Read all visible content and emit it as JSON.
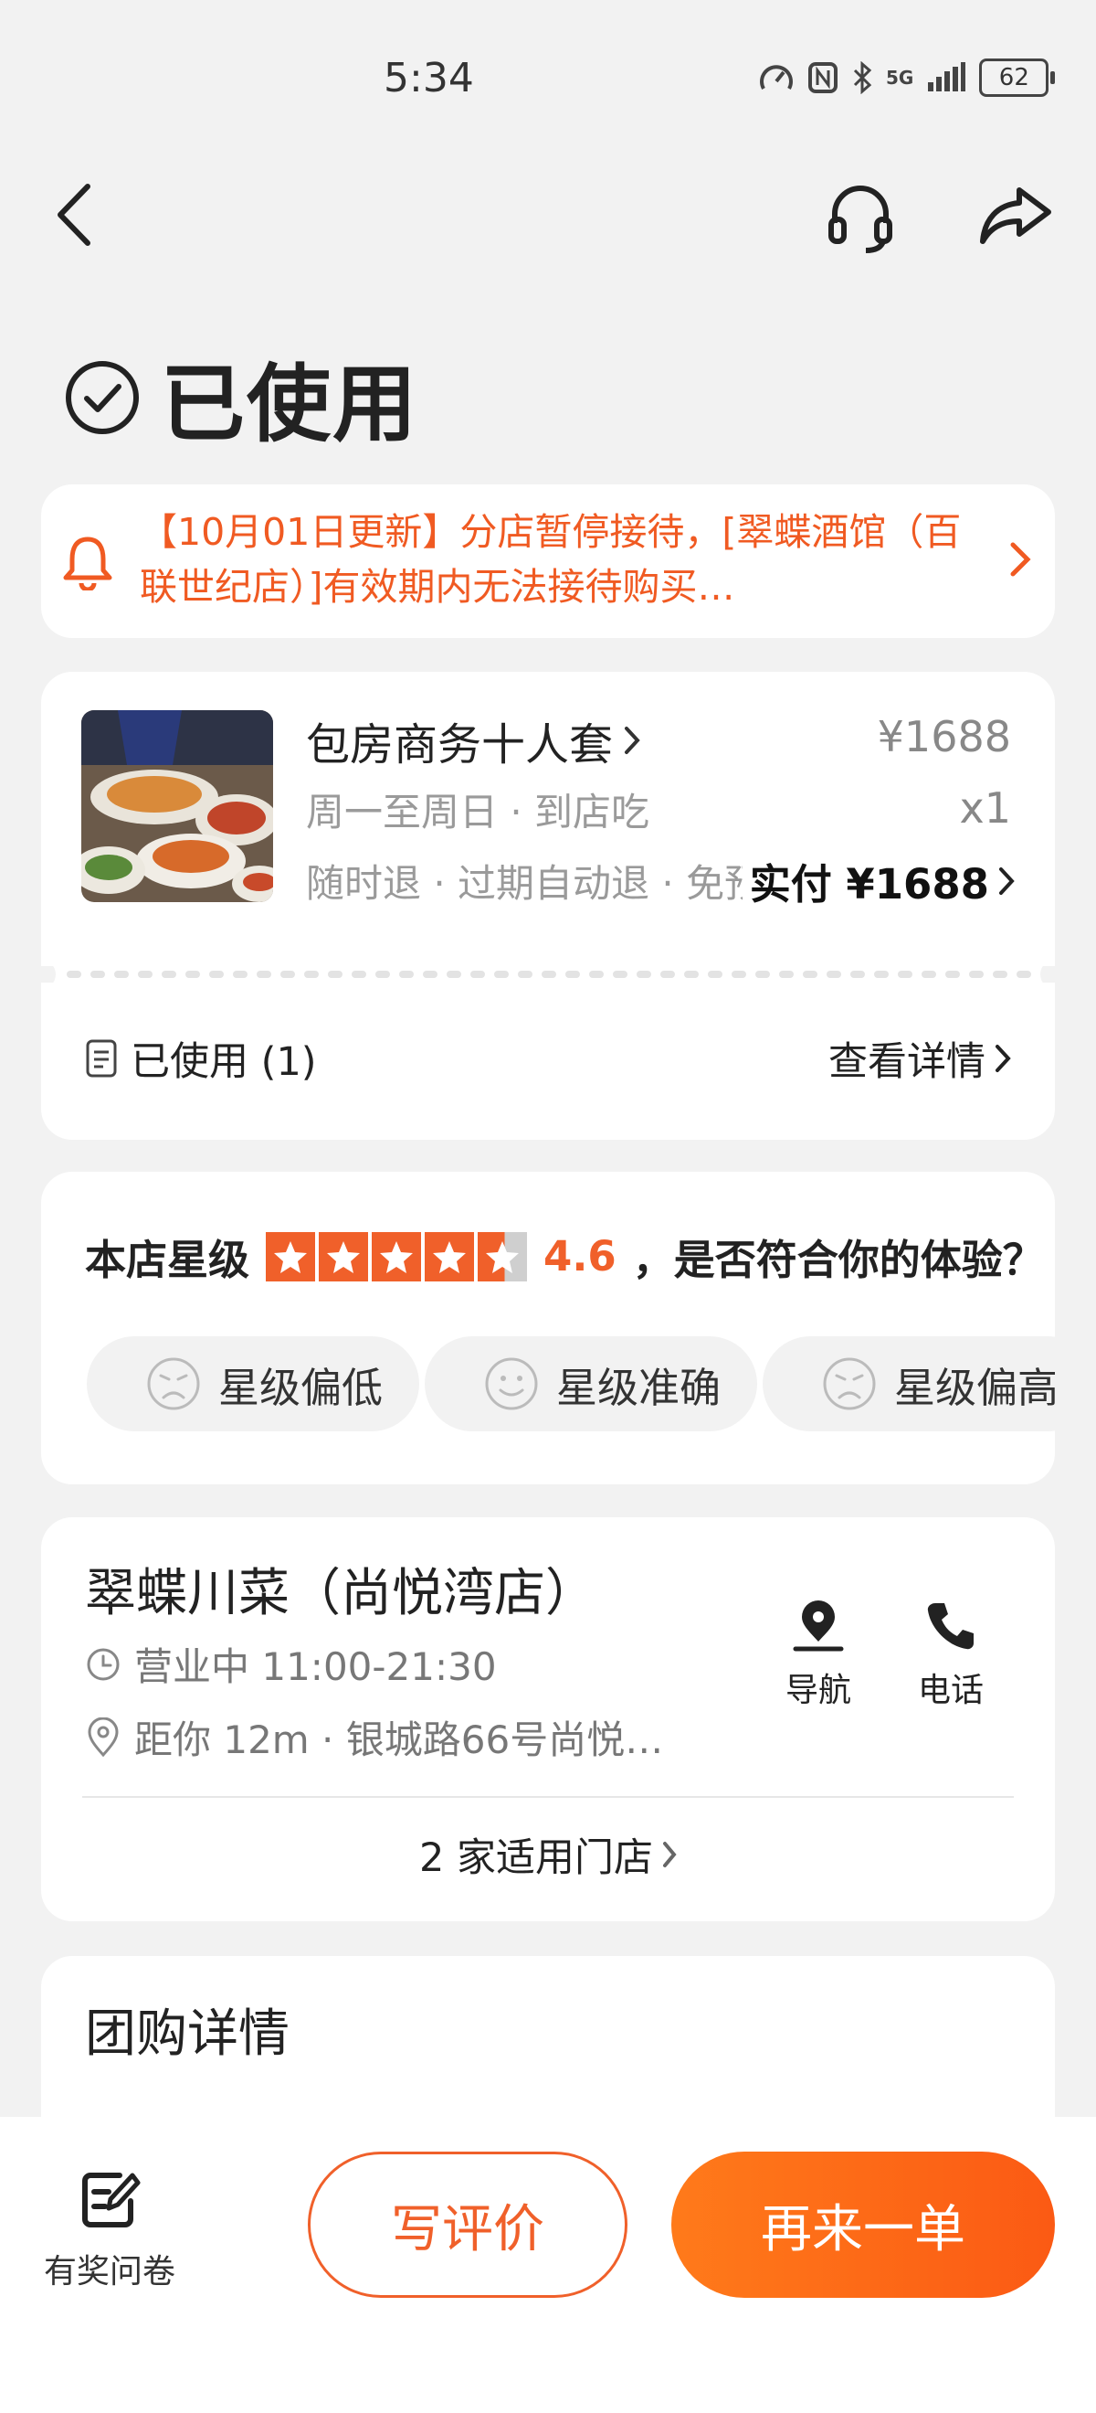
{
  "status_bar": {
    "time": "5:34",
    "network": "5G",
    "battery": "62"
  },
  "header": {
    "title": "已使用"
  },
  "notice": {
    "text": "【10月01日更新】分店暂停接待，[翠蝶酒馆（百联世纪店）]有效期内无法接待购买…"
  },
  "order": {
    "name": "包房商务十人套",
    "meta1": "周一至周日 · 到店吃",
    "meta2": "随时退 · 过期自动退 · 免预约",
    "price": "¥1688",
    "qty": "x1",
    "paid": "实付 ¥1688",
    "used_label": "已使用 (1)",
    "detail_link": "查看详情"
  },
  "rating": {
    "label": "本店星级",
    "score": "4.6",
    "stars_value": 4.6,
    "question": "，是否符合你的体验？",
    "chips": [
      "星级偏低",
      "星级准确",
      "星级偏高"
    ]
  },
  "store": {
    "name": "翠蝶川菜（尚悦湾店）",
    "hours": "营业中 11:00-21:30",
    "address": "距你 12m ·  银城路66号尚悦…",
    "nav_label": "导航",
    "phone_label": "电话",
    "stores_link": "2 家适用门店"
  },
  "group": {
    "title": "团购详情"
  },
  "bottom": {
    "survey_label": "有奖问卷",
    "review_button": "写评价",
    "reorder_button": "再来一单"
  },
  "colors": {
    "accent": "#f0602a",
    "background": "#f2f2f2"
  }
}
